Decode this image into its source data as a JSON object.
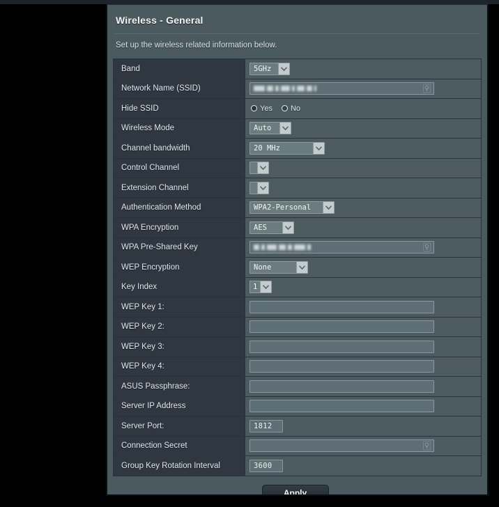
{
  "panel": {
    "title": "Wireless - General",
    "subtitle": "Set up the wireless related information below.",
    "apply_label": "Apply"
  },
  "icons": {
    "chevron_down": "chevron-down-icon",
    "reveal": "eye-reveal-icon"
  },
  "radio": {
    "yes_label": "Yes",
    "no_label": "No"
  },
  "rows": [
    {
      "label": "Band",
      "control": "select",
      "value": "5GHz",
      "width": "w-band"
    },
    {
      "label": "Network Name (SSID)",
      "control": "text-redacted"
    },
    {
      "label": "Hide SSID",
      "control": "radio",
      "selected": "No"
    },
    {
      "label": "Wireless Mode",
      "control": "select",
      "value": "Auto",
      "width": "w-auto"
    },
    {
      "label": "Channel bandwidth",
      "control": "select",
      "value": "20 MHz",
      "width": "w-chbw"
    },
    {
      "label": "Control Channel",
      "control": "select",
      "value": "",
      "width": "w-empty"
    },
    {
      "label": "Extension Channel",
      "control": "select",
      "value": "",
      "width": "w-empty"
    },
    {
      "label": "Authentication Method",
      "control": "select",
      "value": "WPA2-Personal",
      "width": "w-auth"
    },
    {
      "label": "WPA Encryption",
      "control": "select",
      "value": "AES",
      "width": "w-aes"
    },
    {
      "label": "WPA Pre-Shared Key",
      "control": "text-redacted-reveal"
    },
    {
      "label": "WEP Encryption",
      "control": "select",
      "value": "None",
      "width": "w-none"
    },
    {
      "label": "Key Index",
      "control": "select",
      "value": "1",
      "width": "w-key"
    },
    {
      "label": "WEP Key 1:",
      "control": "text",
      "value": ""
    },
    {
      "label": "WEP Key 2:",
      "control": "text",
      "value": ""
    },
    {
      "label": "WEP Key 3:",
      "control": "text",
      "value": ""
    },
    {
      "label": "WEP Key 4:",
      "control": "text",
      "value": ""
    },
    {
      "label": "ASUS Passphrase:",
      "control": "text",
      "value": ""
    },
    {
      "label": "Server IP Address",
      "control": "text",
      "value": ""
    },
    {
      "label": "Server Port:",
      "control": "text-short",
      "value": "1812"
    },
    {
      "label": "Connection Secret",
      "control": "text-reveal",
      "value": ""
    },
    {
      "label": "Group Key Rotation Interval",
      "control": "text-short",
      "value": "3600"
    }
  ],
  "colors": {
    "panel_bg": "#4b5a5e",
    "label_bg": "#2f3840",
    "value_bg": "#4c5b5f",
    "field_bg": "#5d6f74",
    "select_bg": "#6b7c80",
    "arrow_bg": "#c3cbcc",
    "text": "#e2e8ea",
    "page_bg": "#000000"
  }
}
